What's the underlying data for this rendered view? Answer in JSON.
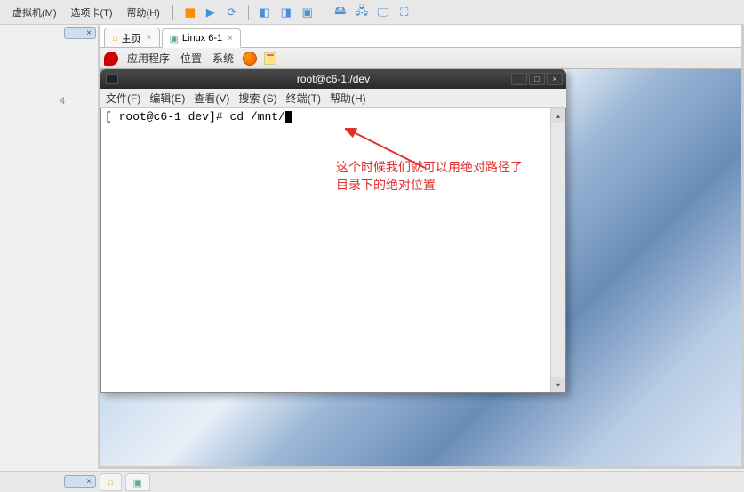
{
  "host": {
    "menu_items": [
      "虚拟机(M)",
      "选项卡(T)",
      "帮助(H)"
    ],
    "toolbar_icons": [
      "pause",
      "play",
      "restart",
      "usb",
      "snapshot",
      "disk1",
      "disk2",
      "network",
      "fullscreen"
    ]
  },
  "vm_tabs": {
    "home_label": "主页",
    "active_label": "Linux 6-1"
  },
  "gnome": {
    "app_menu": "应用程序",
    "places_menu": "位置",
    "system_menu": "系统"
  },
  "terminal": {
    "title": "root@c6-1:/dev",
    "menus": [
      "文件(F)",
      "编辑(E)",
      "查看(V)",
      "搜索 (S)",
      "终端(T)",
      "帮助(H)"
    ],
    "prompt": "[ root@c6-1 dev]# ",
    "command": "cd /mnt/"
  },
  "annotation": {
    "line1": "这个时候我们就可以用绝对路径了",
    "line2": "目录下的绝对位置"
  },
  "page_number": "4",
  "close_sym": "×",
  "win": {
    "min": "_",
    "max": "□",
    "close": "×"
  }
}
